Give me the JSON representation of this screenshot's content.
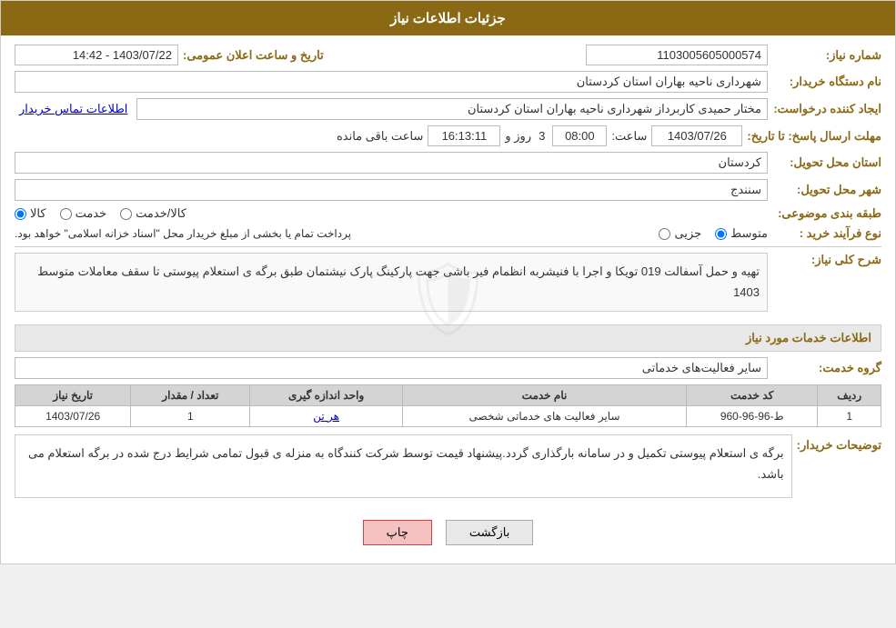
{
  "header": {
    "title": "جزئیات اطلاعات نیاز"
  },
  "fields": {
    "need_number_label": "شماره نیاز:",
    "need_number_value": "1103005605000574",
    "buyer_org_label": "نام دستگاه خریدار:",
    "buyer_org_value": "شهرداری ناحیه بهاران استان کردستان",
    "creator_label": "ایجاد کننده درخواست:",
    "creator_value": "مختار حمیدی کاربرداز شهرداری ناحیه بهاران استان کردستان",
    "contact_link": "اطلاعات تماس خریدار",
    "send_date_label": "مهلت ارسال پاسخ: تا تاریخ:",
    "date_value": "1403/07/26",
    "time_label": "ساعت:",
    "time_value": "08:00",
    "days_label": "روز و",
    "days_value": "3",
    "remaining_label": "ساعت باقی مانده",
    "remaining_value": "16:13:11",
    "province_label": "استان محل تحویل:",
    "province_value": "کردستان",
    "city_label": "شهر محل تحویل:",
    "city_value": "سنندج",
    "category_label": "طبقه بندی موضوعی:",
    "category_options": [
      "کالا",
      "خدمت",
      "کالا/خدمت"
    ],
    "category_selected": "کالا",
    "process_label": "نوع فرآیند خرید :",
    "process_options": [
      "جزیی",
      "متوسط",
      "..."
    ],
    "process_note": "پرداخت تمام یا بخشی از مبلغ خریدار محل \"اسناد خزانه اسلامی\" خواهد بود.",
    "description_label": "شرح کلی نیاز:",
    "description_value": "تهیه و حمل آسفالت 019 تویکا و اجرا با فنیشربه انظمام فیر باشی جهت پارکینگ پارک نیشتمان طبق برگه ی استعلام پیوستی تا سقف معاملات متوسط 1403",
    "services_title": "اطلاعات خدمات مورد نیاز",
    "service_group_label": "گروه خدمت:",
    "service_group_value": "سایر فعالیت‌های خدماتی",
    "table": {
      "headers": [
        "ردیف",
        "کد خدمت",
        "نام خدمت",
        "واحد اندازه گیری",
        "تعداد / مقدار",
        "تاریخ نیاز"
      ],
      "rows": [
        {
          "row_num": "1",
          "service_code": "ط-96-96-960",
          "service_name": "سایر فعالیت های خدماتی شخصی",
          "unit": "هر تن",
          "quantity": "1",
          "date": "1403/07/26"
        }
      ]
    },
    "buyer_notes_label": "توضیحات خریدار:",
    "buyer_notes_value": "برگه ی استعلام پیوستی تکمیل و در سامانه بارگذاری گردد.پیشنهاد قیمت توسط شرکت کنندگاه به منزله ی قبول تمامی شرایط درج شده در برگه استعلام می باشد."
  },
  "buttons": {
    "back_label": "بازگشت",
    "print_label": "چاپ"
  },
  "announce_date_label": "تاریخ و ساعت اعلان عمومی:",
  "announce_date_value": "1403/07/22 - 14:42"
}
